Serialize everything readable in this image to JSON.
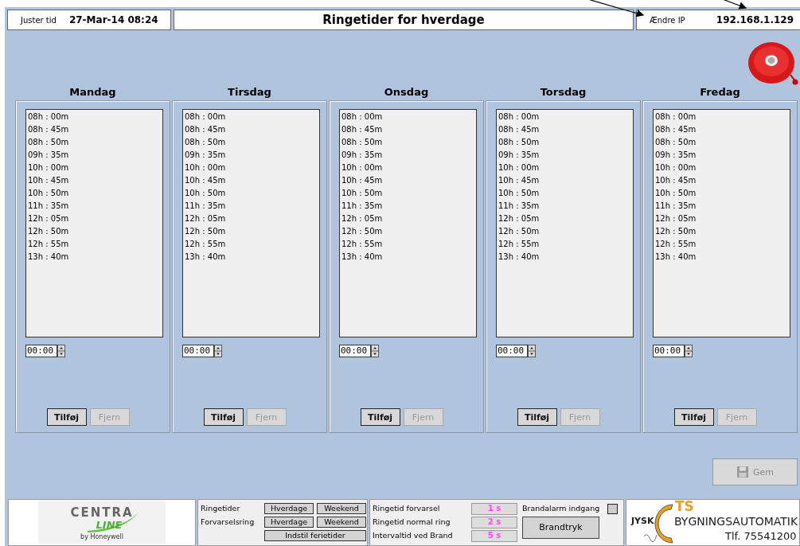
{
  "top_bar": {
    "clock_label": "Juster tid",
    "clock_value": "27-Mar-14 08:24",
    "title": "Ringetider for hverdage",
    "ip_label": "Ændre IP",
    "ip_value": "192.168.1.129"
  },
  "days": [
    {
      "name": "Mandag",
      "times": [
        "08h : 00m",
        "08h : 45m",
        "08h : 50m",
        "09h : 35m",
        "10h : 00m",
        "10h : 45m",
        "10h : 50m",
        "11h : 35m",
        "12h : 05m",
        "12h : 50m",
        "12h : 55m",
        "13h : 40m"
      ],
      "time_input": "00:00",
      "add_button": {
        "label": "Tilføj",
        "disabled": false
      },
      "remove_button": {
        "label": "Fjern",
        "disabled": true
      }
    },
    {
      "name": "Tirsdag",
      "times": [
        "08h : 00m",
        "08h : 45m",
        "08h : 50m",
        "09h : 35m",
        "10h : 00m",
        "10h : 45m",
        "10h : 50m",
        "11h : 35m",
        "12h : 05m",
        "12h : 50m",
        "12h : 55m",
        "13h : 40m"
      ],
      "time_input": "00:00",
      "add_button": {
        "label": "Tilføj",
        "disabled": false
      },
      "remove_button": {
        "label": "Fjern",
        "disabled": true
      }
    },
    {
      "name": "Onsdag",
      "times": [
        "08h : 00m",
        "08h : 45m",
        "08h : 50m",
        "09h : 35m",
        "10h : 00m",
        "10h : 45m",
        "10h : 50m",
        "11h : 35m",
        "12h : 05m",
        "12h : 50m",
        "12h : 55m",
        "13h : 40m"
      ],
      "time_input": "00:00",
      "add_button": {
        "label": "Tilføj",
        "disabled": false
      },
      "remove_button": {
        "label": "Fjern",
        "disabled": true
      }
    },
    {
      "name": "Torsdag",
      "times": [
        "08h : 00m",
        "08h : 45m",
        "08h : 50m",
        "09h : 35m",
        "10h : 00m",
        "10h : 45m",
        "10h : 50m",
        "11h : 35m",
        "12h : 05m",
        "12h : 50m",
        "12h : 55m",
        "13h : 40m"
      ],
      "time_input": "00:00",
      "add_button": {
        "label": "Tilføj",
        "disabled": false
      },
      "remove_button": {
        "label": "Fjern",
        "disabled": true
      }
    },
    {
      "name": "Fredag",
      "times": [
        "08h : 00m",
        "08h : 45m",
        "08h : 50m",
        "09h : 35m",
        "10h : 00m",
        "10h : 45m",
        "10h : 50m",
        "11h : 35m",
        "12h : 05m",
        "12h : 50m",
        "12h : 55m",
        "13h : 40m"
      ],
      "time_input": "00:00",
      "add_button": {
        "label": "Tilføj",
        "disabled": false
      },
      "remove_button": {
        "label": "Fjern",
        "disabled": true
      }
    }
  ],
  "save_button": {
    "label": "Gem",
    "disabled": true
  },
  "bottom": {
    "centraline_logo": {
      "line1": "CENTRA",
      "line2": "LINE",
      "line3": "by Honeywell"
    },
    "ring_rows": [
      {
        "label": "Ringetider",
        "buttons": [
          "Hverdage",
          "Weekend"
        ]
      },
      {
        "label": "Forvarselsring",
        "buttons": [
          "Hverdage",
          "Weekend"
        ]
      }
    ],
    "holiday_button": "Indstil ferietider",
    "params": [
      {
        "label": "Ringetid forvarsel",
        "value": "1 s"
      },
      {
        "label": "Ringetid normal ring",
        "value": "2 s"
      },
      {
        "label": "Intervaltid ved Brand",
        "value": "5 s"
      }
    ],
    "fire_input": {
      "label": "Brandalarm indgang",
      "checked": false
    },
    "fire_button": "Brandtryk",
    "cts_logo": {
      "jysk": "JYSK",
      "cts": "TS",
      "name": "BYGNINGSAUTOMATIK",
      "phone": "Tlf. 75541200"
    }
  }
}
